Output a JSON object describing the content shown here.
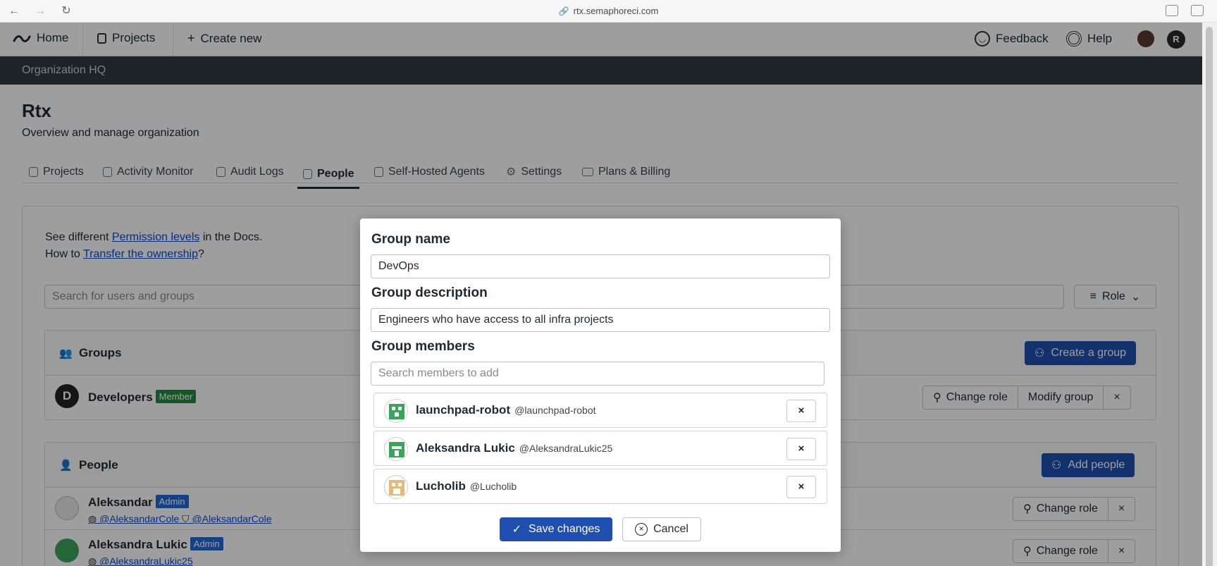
{
  "browser": {
    "url": "rtx.semaphoreci.com"
  },
  "appnav": {
    "home": "Home",
    "projects": "Projects",
    "create_new": "Create new",
    "feedback": "Feedback",
    "help": "Help",
    "user_initial": "R"
  },
  "org_strip": "Organization HQ",
  "page": {
    "title": "Rtx",
    "subtitle": "Overview and manage organization"
  },
  "tabs": [
    {
      "label": "Projects"
    },
    {
      "label": "Activity Monitor"
    },
    {
      "label": "Audit Logs"
    },
    {
      "label": "People"
    },
    {
      "label": "Self-Hosted Agents"
    },
    {
      "label": "Settings"
    },
    {
      "label": "Plans & Billing"
    }
  ],
  "docs": {
    "line1_pre": "See different",
    "line1_link": "Permission levels",
    "line1_post": "in the Docs.",
    "line2_pre": "How to",
    "line2_link": "Transfer the ownership",
    "line2_post": "?"
  },
  "search_users_placeholder": "Search for users and groups",
  "role_filter": "Role",
  "groups": {
    "title": "Groups",
    "create_button": "Create a group",
    "items": [
      {
        "initial": "D",
        "name": "Developers",
        "badge": "Member",
        "change_role": "Change role",
        "modify": "Modify group",
        "remove": "×"
      }
    ]
  },
  "people": {
    "title": "People",
    "add_button": "Add people",
    "items": [
      {
        "name": "Aleksandar",
        "badge": "Admin",
        "handle1": "@AleksandarCole",
        "handle2": "@AleksandarCole",
        "change_role": "Change role",
        "remove": "×"
      },
      {
        "name": "Aleksandra Lukic",
        "badge": "Admin",
        "handle1": "@AleksandraLukic25",
        "change_role": "Change role",
        "remove": "×"
      }
    ]
  },
  "modal": {
    "group_name_label": "Group name",
    "group_name_value": "DevOps",
    "group_description_label": "Group description",
    "group_description_value": "Engineers who have access to all infra projects",
    "group_members_label": "Group members",
    "member_search_placeholder": "Search members to add",
    "members": [
      {
        "name": "launchpad-robot",
        "handle": "@launchpad-robot",
        "remove": "×",
        "avatar_color": "#3aa55a"
      },
      {
        "name": "Aleksandra Lukic",
        "handle": "@AleksandraLukic25",
        "remove": "×",
        "avatar_color": "#3aa55a"
      },
      {
        "name": "Lucholib",
        "handle": "@Lucholib",
        "remove": "×",
        "avatar_color": "#e6b87a"
      }
    ],
    "save_label": "Save changes",
    "cancel_label": "Cancel"
  },
  "colors": {
    "primary": "#1f4fb0",
    "member_badge": "#1e8e3e",
    "admin_badge": "#1f6ad6",
    "org_strip": "#2e3b40"
  }
}
